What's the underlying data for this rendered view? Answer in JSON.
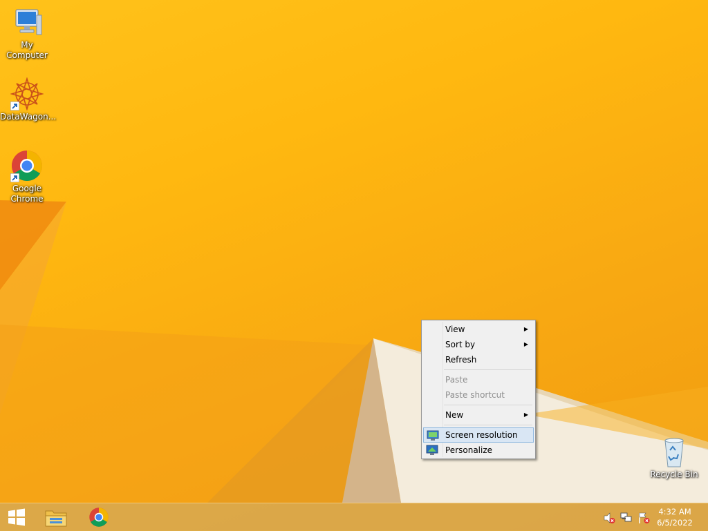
{
  "desktop": {
    "icons": [
      {
        "label": "My Computer",
        "icon": "computer-icon"
      },
      {
        "label": "DataWagon...",
        "icon": "datawagon-icon"
      },
      {
        "label_line1": "Google",
        "label_line2": "Chrome",
        "icon": "chrome-icon"
      },
      {
        "label": "Recycle Bin",
        "icon": "recycle-bin-icon"
      }
    ]
  },
  "context_menu": {
    "items": [
      {
        "label": "View",
        "submenu": true
      },
      {
        "label": "Sort by",
        "submenu": true
      },
      {
        "label": "Refresh"
      },
      {
        "label": "Paste",
        "disabled": true
      },
      {
        "label": "Paste shortcut",
        "disabled": true
      },
      {
        "label": "New",
        "submenu": true
      },
      {
        "label": "Screen resolution",
        "icon": "screen-resolution-icon",
        "highlighted": true
      },
      {
        "label": "Personalize",
        "icon": "personalize-icon"
      }
    ]
  },
  "taskbar": {
    "buttons": [
      "start-icon",
      "file-explorer-icon",
      "chrome-icon"
    ],
    "tray": [
      "volume-muted-icon",
      "network-icon",
      "action-center-icon"
    ],
    "time": "4:32 AM",
    "date": "6/5/2022"
  },
  "colors": {
    "wallpaper": "#ffb810",
    "menu_highlight": "#d9e6f4",
    "taskbar": "#d6a854"
  }
}
